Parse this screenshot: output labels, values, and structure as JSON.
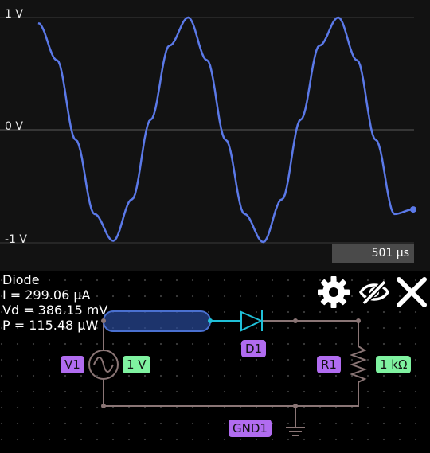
{
  "scope": {
    "y_labels": {
      "top": "1 V",
      "mid": "0 V",
      "bottom": "-1 V"
    },
    "time_label": "501 µs",
    "trace_color": "#5b79e8"
  },
  "chart_data": {
    "type": "line",
    "series": [
      {
        "values": [
          0.95,
          0.62,
          -0.09,
          -0.75,
          -0.99,
          -0.62,
          0.09,
          0.75,
          1.0,
          0.62,
          -0.09,
          -0.75,
          -1.0,
          -0.62,
          0.09,
          0.75,
          1.0,
          0.62,
          -0.09,
          -0.75,
          -0.71
        ]
      }
    ],
    "ylim": [
      -1,
      1
    ],
    "y_ticks": [
      "1 V",
      "0 V",
      "-1 V"
    ],
    "x_end_label": "501 µs"
  },
  "info": {
    "name": "Diode",
    "current": "I = 299.06 µA",
    "voltage": "Vd = 386.15 mV",
    "power": "P = 115.48 µW"
  },
  "toolbar": {
    "settings_icon": "gear-icon",
    "hide_icon": "eye-off-icon",
    "close_icon": "close-icon"
  },
  "components": {
    "v1_label": "V1",
    "v1_value": "1 V",
    "d1_label": "D1",
    "r1_label": "R1",
    "r1_value": "1 kΩ",
    "gnd_label": "GND1"
  },
  "colors": {
    "wire": "#8a7575",
    "selected_wire": "#3c5fb0",
    "diode": "#20c0d8",
    "tag_purple": "#b16cf0",
    "tag_green": "#7ff2a0"
  }
}
